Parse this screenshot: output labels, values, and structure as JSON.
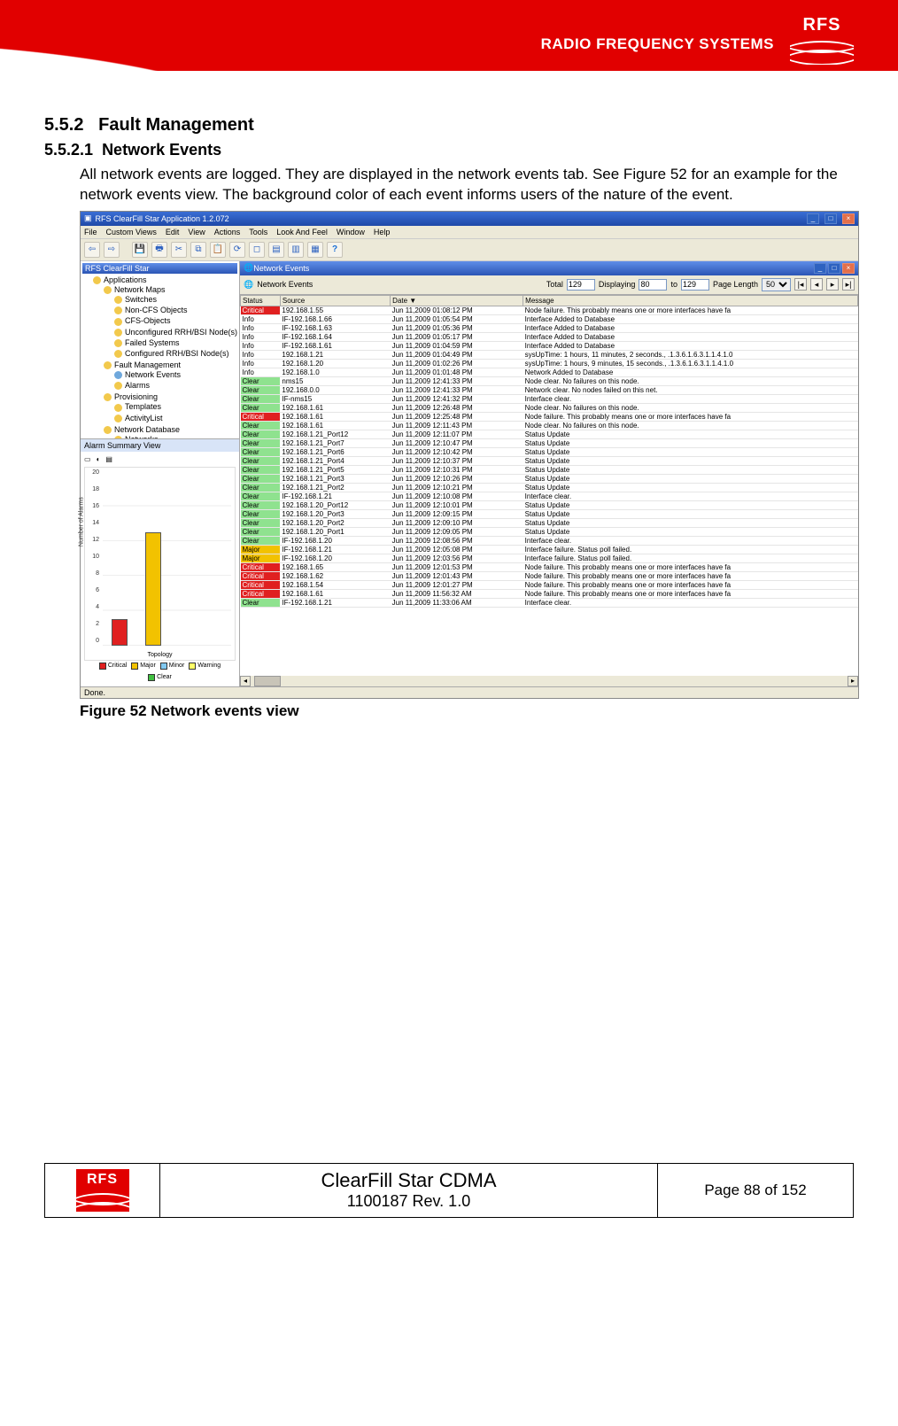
{
  "header": {
    "tagline": "RADIO FREQUENCY SYSTEMS",
    "logo_text": "RFS"
  },
  "section": {
    "num1": "5.5.2",
    "title1": "Fault Management",
    "num2": "5.5.2.1",
    "title2": "Network Events",
    "para": "All network events are logged. They are displayed in the network events tab. See Figure 52 for an example for the network events view. The background color of each event informs users of the nature of the event.",
    "figcaption": "Figure 52 Network events view"
  },
  "app": {
    "title": "RFS ClearFill Star Application 1.2.072",
    "menus": [
      "File",
      "Custom Views",
      "Edit",
      "View",
      "Actions",
      "Tools",
      "Look And Feel",
      "Window",
      "Help"
    ],
    "tree_title": "RFS ClearFill Star",
    "tree": [
      {
        "l": "Applications",
        "children": [
          {
            "l": "Network Maps",
            "children": [
              {
                "l": "Switches"
              },
              {
                "l": "Non-CFS Objects"
              },
              {
                "l": "CFS-Objects"
              },
              {
                "l": "Unconfigured RRH/BSI Node(s)"
              },
              {
                "l": "Failed Systems"
              },
              {
                "l": "Configured RRH/BSI Node(s)"
              }
            ]
          },
          {
            "l": "Fault Management",
            "children": [
              {
                "l": "Network Events",
                "sel": true
              },
              {
                "l": "Alarms"
              }
            ]
          },
          {
            "l": "Provisioning",
            "children": [
              {
                "l": "Templates"
              },
              {
                "l": "ActivityList"
              }
            ]
          },
          {
            "l": "Network Database",
            "children": [
              {
                "l": "Networks"
              }
            ]
          }
        ]
      }
    ],
    "alarm_header": "Alarm Summary View",
    "inner_title": "Network Events",
    "tab_label": "Network Events",
    "filter": {
      "total_label": "Total",
      "total": "129",
      "disp_label": "Displaying",
      "from": "80",
      "to_label": "to",
      "to": "129",
      "pl_label": "Page Length",
      "pl": "50"
    },
    "cols": [
      "Status",
      "Source",
      "Date ▼",
      "Message"
    ],
    "rows": [
      {
        "s": "Critical",
        "src": "192.168.1.55",
        "d": "Jun 11,2009 01:08:12 PM",
        "m": "Node failure. This probably means one or more interfaces have fa"
      },
      {
        "s": "Info",
        "src": "IF-192.168.1.66",
        "d": "Jun 11,2009 01:05:54 PM",
        "m": "Interface Added to Database"
      },
      {
        "s": "Info",
        "src": "IF-192.168.1.63",
        "d": "Jun 11,2009 01:05:36 PM",
        "m": "Interface Added to Database"
      },
      {
        "s": "Info",
        "src": "IF-192.168.1.64",
        "d": "Jun 11,2009 01:05:17 PM",
        "m": "Interface Added to Database"
      },
      {
        "s": "Info",
        "src": "IF-192.168.1.61",
        "d": "Jun 11,2009 01:04:59 PM",
        "m": "Interface Added to Database"
      },
      {
        "s": "Info",
        "src": "192.168.1.21",
        "d": "Jun 11,2009 01:04:49 PM",
        "m": "sysUpTime: 1 hours, 11 minutes, 2 seconds., .1.3.6.1.6.3.1.1.4.1.0"
      },
      {
        "s": "Info",
        "src": "192.168.1.20",
        "d": "Jun 11,2009 01:02:26 PM",
        "m": "sysUpTime: 1 hours, 9 minutes, 15 seconds., .1.3.6.1.6.3.1.1.4.1.0"
      },
      {
        "s": "Info",
        "src": "192.168.1.0",
        "d": "Jun 11,2009 01:01:48 PM",
        "m": "Network Added to Database"
      },
      {
        "s": "Clear",
        "src": "nms15",
        "d": "Jun 11,2009 12:41:33 PM",
        "m": "Node clear.  No failures on this node."
      },
      {
        "s": "Clear",
        "src": "192.168.0.0",
        "d": "Jun 11,2009 12:41:33 PM",
        "m": "Network clear.  No nodes failed on this net."
      },
      {
        "s": "Clear",
        "src": "IF-nms15",
        "d": "Jun 11,2009 12:41:32 PM",
        "m": "Interface clear."
      },
      {
        "s": "Clear",
        "src": "192.168.1.61",
        "d": "Jun 11,2009 12:26:48 PM",
        "m": "Node clear.  No failures on this node."
      },
      {
        "s": "Critical",
        "src": "192.168.1.61",
        "d": "Jun 11,2009 12:25:48 PM",
        "m": "Node failure. This probably means one or more interfaces have fa"
      },
      {
        "s": "Clear",
        "src": "192.168.1.61",
        "d": "Jun 11,2009 12:11:43 PM",
        "m": "Node clear.  No failures on this node."
      },
      {
        "s": "Clear",
        "src": "192.168.1.21_Port12",
        "d": "Jun 11,2009 12:11:07 PM",
        "m": "Status Update"
      },
      {
        "s": "Clear",
        "src": "192.168.1.21_Port7",
        "d": "Jun 11,2009 12:10:47 PM",
        "m": "Status Update"
      },
      {
        "s": "Clear",
        "src": "192.168.1.21_Port6",
        "d": "Jun 11,2009 12:10:42 PM",
        "m": "Status Update"
      },
      {
        "s": "Clear",
        "src": "192.168.1.21_Port4",
        "d": "Jun 11,2009 12:10:37 PM",
        "m": "Status Update"
      },
      {
        "s": "Clear",
        "src": "192.168.1.21_Port5",
        "d": "Jun 11,2009 12:10:31 PM",
        "m": "Status Update"
      },
      {
        "s": "Clear",
        "src": "192.168.1.21_Port3",
        "d": "Jun 11,2009 12:10:26 PM",
        "m": "Status Update"
      },
      {
        "s": "Clear",
        "src": "192.168.1.21_Port2",
        "d": "Jun 11,2009 12:10:21 PM",
        "m": "Status Update"
      },
      {
        "s": "Clear",
        "src": "IF-192.168.1.21",
        "d": "Jun 11,2009 12:10:08 PM",
        "m": "Interface clear."
      },
      {
        "s": "Clear",
        "src": "192.168.1.20_Port12",
        "d": "Jun 11,2009 12:10:01 PM",
        "m": "Status Update"
      },
      {
        "s": "Clear",
        "src": "192.168.1.20_Port3",
        "d": "Jun 11,2009 12:09:15 PM",
        "m": "Status Update"
      },
      {
        "s": "Clear",
        "src": "192.168.1.20_Port2",
        "d": "Jun 11,2009 12:09:10 PM",
        "m": "Status Update"
      },
      {
        "s": "Clear",
        "src": "192.168.1.20_Port1",
        "d": "Jun 11,2009 12:09:05 PM",
        "m": "Status Update"
      },
      {
        "s": "Clear",
        "src": "IF-192.168.1.20",
        "d": "Jun 11,2009 12:08:56 PM",
        "m": "Interface clear."
      },
      {
        "s": "Major",
        "src": "IF-192.168.1.21",
        "d": "Jun 11,2009 12:05:08 PM",
        "m": "Interface failure. Status poll failed."
      },
      {
        "s": "Major",
        "src": "IF-192.168.1.20",
        "d": "Jun 11,2009 12:03:56 PM",
        "m": "Interface failure. Status poll failed."
      },
      {
        "s": "Critical",
        "src": "192.168.1.65",
        "d": "Jun 11,2009 12:01:53 PM",
        "m": "Node failure. This probably means one or more interfaces have fa"
      },
      {
        "s": "Critical",
        "src": "192.168.1.62",
        "d": "Jun 11,2009 12:01:43 PM",
        "m": "Node failure. This probably means one or more interfaces have fa"
      },
      {
        "s": "Critical",
        "src": "192.168.1.54",
        "d": "Jun 11,2009 12:01:27 PM",
        "m": "Node failure. This probably means one or more interfaces have fa"
      },
      {
        "s": "Critical",
        "src": "192.168.1.61",
        "d": "Jun 11,2009 11:56:32 AM",
        "m": "Node failure. This probably means one or more interfaces have fa"
      },
      {
        "s": "Clear",
        "src": "IF-192.168.1.21",
        "d": "Jun 11,2009 11:33:06 AM",
        "m": "Interface clear."
      }
    ],
    "statusbar": "Done."
  },
  "chart_data": {
    "type": "bar",
    "title": "Alarm Summary View",
    "xlabel": "Topology",
    "ylabel": "Number of Alarms",
    "ylim": [
      0,
      20
    ],
    "yticks": [
      0,
      2,
      4,
      6,
      8,
      10,
      12,
      14,
      16,
      18,
      20
    ],
    "categories": [
      "Critical",
      "Major",
      "Minor",
      "Warning",
      "Clear"
    ],
    "values": [
      3,
      13,
      0,
      0,
      0
    ],
    "colors": [
      "#e02020",
      "#f2c200",
      "#80c8f0",
      "#ffff66",
      "#40c040"
    ],
    "legend": [
      "Critical",
      "Major",
      "Minor",
      "Warning",
      "Clear"
    ]
  },
  "footer": {
    "logo": "RFS",
    "title": "ClearFill Star CDMA",
    "sub": "1100187 Rev. 1.0",
    "page": "Page 88 of 152"
  }
}
